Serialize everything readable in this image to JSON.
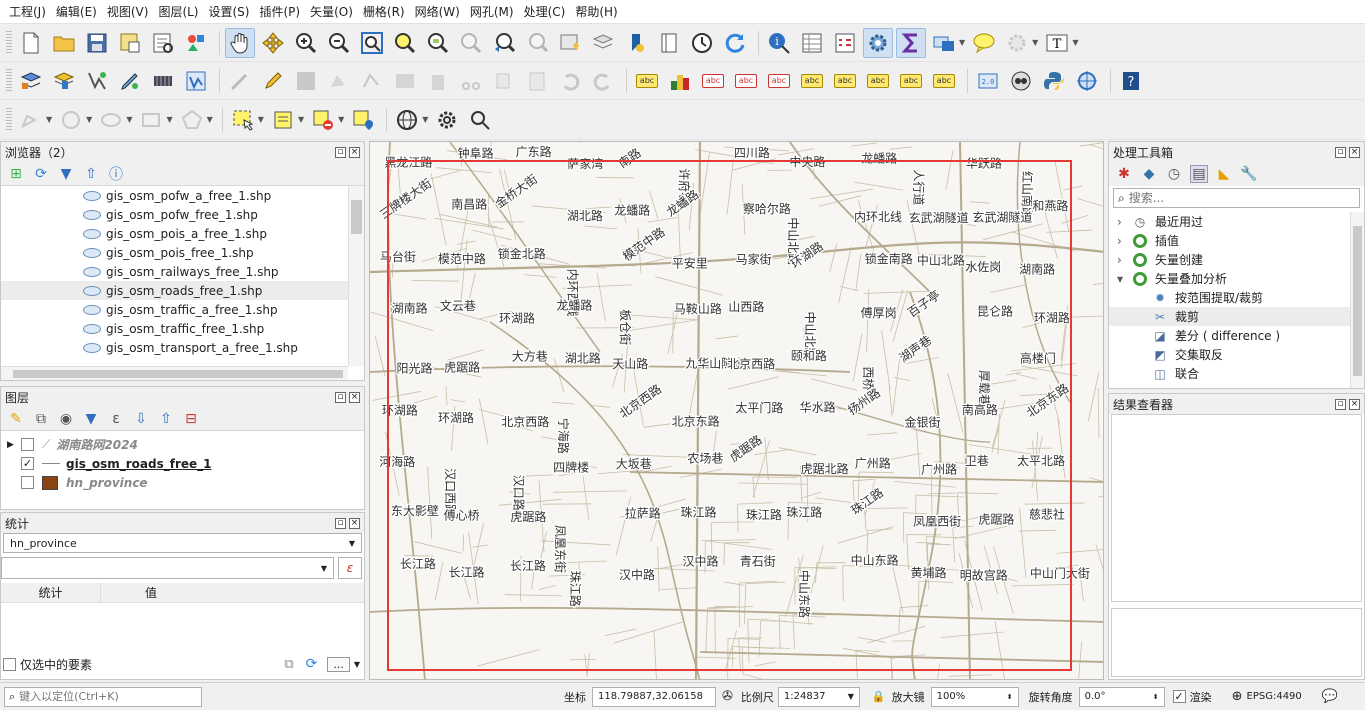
{
  "menu": [
    "工程(J)",
    "编辑(E)",
    "视图(V)",
    "图层(L)",
    "设置(S)",
    "插件(P)",
    "矢量(O)",
    "栅格(R)",
    "网络(W)",
    "网孔(M)",
    "处理(C)",
    "帮助(H)"
  ],
  "label_toolbar": [
    "abc",
    "abc",
    "abc",
    "abc",
    "abc",
    "abc",
    "abc",
    "abc",
    "abc"
  ],
  "browser": {
    "title": "浏览器（2）",
    "files": [
      "gis_osm_pofw_a_free_1.shp",
      "gis_osm_pofw_free_1.shp",
      "gis_osm_pois_a_free_1.shp",
      "gis_osm_pois_free_1.shp",
      "gis_osm_railways_free_1.shp",
      "gis_osm_roads_free_1.shp",
      "gis_osm_traffic_a_free_1.shp",
      "gis_osm_traffic_free_1.shp",
      "gis_osm_transport_a_free_1.shp"
    ],
    "selected_file": "gis_osm_roads_free_1.shp"
  },
  "layers": {
    "title": "图层",
    "items": [
      {
        "name": "湖南路网2024",
        "checked": false
      },
      {
        "name": "gis_osm_roads_free_1",
        "checked": true
      },
      {
        "name": "hn_province",
        "checked": false
      }
    ]
  },
  "stats": {
    "title": "统计",
    "layer_select": "hn_province",
    "col_stat": "统计",
    "col_value": "值",
    "only_selected": "仅选中的要素",
    "dots": "..."
  },
  "locator": {
    "placeholder": "键入以定位(Ctrl+K)"
  },
  "toolbox": {
    "title": "处理工具箱",
    "search_placeholder": "搜索...",
    "items": [
      {
        "label": "最近用过",
        "level": 0,
        "expanded": false,
        "icon": "clock-icon"
      },
      {
        "label": "插值",
        "level": 0,
        "expanded": false,
        "icon": "qgis-icon"
      },
      {
        "label": "矢量创建",
        "level": 0,
        "expanded": false,
        "icon": "qgis-icon"
      },
      {
        "label": "矢量叠加分析",
        "level": 0,
        "expanded": true,
        "icon": "qgis-icon"
      },
      {
        "label": "按范围提取/裁剪",
        "level": 1,
        "icon": "gear-icon"
      },
      {
        "label": "裁剪",
        "level": 1,
        "icon": "clip-icon",
        "selected": true
      },
      {
        "label": "差分 ( difference )",
        "level": 1,
        "icon": "difference-icon"
      },
      {
        "label": "交集取反",
        "level": 1,
        "icon": "symdiff-icon"
      },
      {
        "label": "联合",
        "level": 1,
        "icon": "union-icon"
      }
    ]
  },
  "results": {
    "title": "结果查看器"
  },
  "status": {
    "coord_label": "坐标",
    "coord_value": "118.79887,32.06158",
    "scale_label": "比例尺",
    "scale_value": "1:24837",
    "magnifier_label": "放大镜",
    "magnifier_value": "100%",
    "rotation_label": "旋转角度",
    "rotation_value": "0.0°",
    "render_label": "渲染",
    "crs": "EPSG:4490"
  },
  "map_labels": [
    "黑龙江路",
    "钟阜路",
    "广东路",
    "萨家湾",
    "南路",
    "许府巷",
    "四川路",
    "中央路",
    "龙蟠路",
    "人行道",
    "华跃路",
    "红山南路",
    "三牌楼大街",
    "南昌路",
    "金桥大街",
    "湖北路",
    "龙蟠路",
    "龙蟠路",
    "察哈尔路",
    "中山北路",
    "内环北线",
    "玄武湖隧道",
    "玄武湖隧道",
    "和燕路",
    "马台街",
    "模范中路",
    "锁金北路",
    "内环西线",
    "模范中路",
    "平安里",
    "马家街",
    "环湖路",
    "锁金南路",
    "中山北路",
    "水佐岗",
    "湖南路",
    "湖南路",
    "文云巷",
    "环湖路",
    "龙蟠路",
    "板仓街",
    "马鞍山路",
    "山西路",
    "中山北路",
    "傅厚岗",
    "百子亭",
    "昆仑路",
    "环湖路",
    "阳光路",
    "虎踞路",
    "大方巷",
    "湖北路",
    "天山路",
    "九华山隧道",
    "北京西路",
    "颐和路",
    "西桥",
    "湖声巷",
    "厚载巷",
    "高楼门",
    "环湖路",
    "环湖路",
    "北京西路",
    "宁海路",
    "北京西路",
    "北京东路",
    "太平门路",
    "华水路",
    "扬州路",
    "金银街",
    "南高路",
    "北京东路",
    "河海路",
    "汉口西路",
    "汉口路",
    "四牌楼",
    "大坂巷",
    "农场巷",
    "虎踞路",
    "虎踞北路",
    "广州路",
    "广州路",
    "卫巷",
    "太平北路",
    "东大影壁",
    "傅心桥",
    "虎踞路",
    "凤凰东街",
    "拉萨路",
    "珠江路",
    "珠江路",
    "珠江路",
    "珠江路",
    "凤凰西街",
    "虎踞路",
    "慈悲社",
    "长江路",
    "长江路",
    "长江路",
    "珠江路",
    "汉中路",
    "汉中路",
    "青石街",
    "中山东路",
    "中山东路",
    "黄埔路",
    "明故宫路",
    "中山门大街"
  ]
}
